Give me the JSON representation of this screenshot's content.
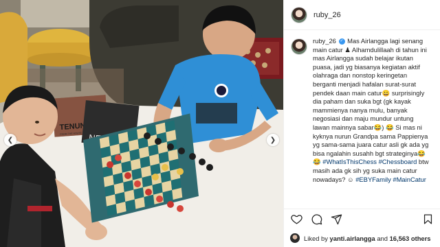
{
  "header": {
    "username": "ruby_26",
    "avatar_icon": "profile-avatar"
  },
  "photo": {
    "book_tenun_title": "TENUN",
    "book_tenun_sub": "FROM THE HOUSE OF FINE TEXTILES",
    "book_two_title": "NEL",
    "colors": {
      "wall": "#c9c3b6",
      "sofa": "#3b3a35",
      "table": "#f1eee8",
      "shirt": "#2f8fd6",
      "board_dark": "#1f6f73",
      "board_light": "#e7d4a3"
    }
  },
  "caption": {
    "username": "ruby_26",
    "text_1": "Mas Airlangga lagi senang main catur ♟ Alhamdulillaah di tahun ini mas Airlangga sudah belajar ikutan puasa, jadi yg biasanya kegiatan aktif olahraga dan nonstop keringetan berganti menjadi hafalan surat-surat pendek daan main catur😀 surprisingly dia paham dan suka bgt (gk kayak mammienya nanya mulu, banyak negosiasi dan maju mundur untung lawan mainnya sabar😂) 😂 Si mas ni kyknya nurun Grandpa sama Pappienya yg sama-sama juara catur asli gk ada yg bisa ngalahin susahh bgt strateginya😂😂 ",
    "hashtag_1": "#WhatIsThisChess",
    "hashtag_2": "#Chessboard",
    "text_2": " btw masih ada gk sih yg suka main catur nowadays? ☺ ",
    "hashtag_3": "#EBYFamily",
    "hashtag_4": "#MainCatur"
  },
  "likes": {
    "prefix": "Liked by",
    "user": "yanti.airlangga",
    "connector": "and",
    "count": "16,563 others"
  },
  "icons": {
    "like": "heart-icon",
    "comment": "comment-icon",
    "share": "share-icon",
    "save": "bookmark-icon"
  }
}
